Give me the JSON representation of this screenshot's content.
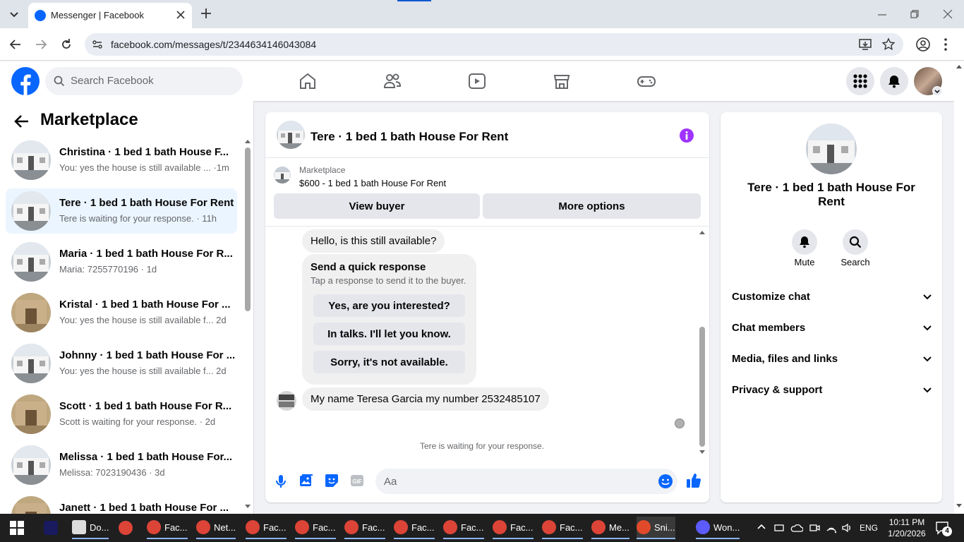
{
  "browser": {
    "tab_title": "Messenger | Facebook",
    "url": "facebook.com/messages/t/2344634146043084"
  },
  "fb": {
    "search_placeholder": "Search Facebook"
  },
  "left": {
    "title": "Marketplace",
    "conversations": [
      {
        "title": "Christina · 1 bed 1 bath House F...",
        "preview": "You: yes the house is still available ... ·1m",
        "thumb": "white"
      },
      {
        "title": "Tere · 1 bed 1 bath House For Rent",
        "preview": "Tere is waiting for your response. · 11h",
        "thumb": "white"
      },
      {
        "title": "Maria · 1 bed 1 bath House For R...",
        "preview": "Maria: 7255770196 · 1d",
        "thumb": "white"
      },
      {
        "title": "Kristal · 1 bed 1 bath House For ...",
        "preview": "You: yes the house is still available f... 2d",
        "thumb": "tan"
      },
      {
        "title": "Johnny · 1 bed 1 bath House For ...",
        "preview": "You: yes the house is still available f... 2d",
        "thumb": "white"
      },
      {
        "title": "Scott · 1 bed 1 bath House For R...",
        "preview": "Scott is waiting for your response. · 2d",
        "thumb": "tan"
      },
      {
        "title": "Melissa · 1 bed 1 bath House For...",
        "preview": "Melissa: 7023190436 · 3d",
        "thumb": "white"
      },
      {
        "title": "Janett · 1 bed 1 bath House For ...",
        "preview": "",
        "thumb": "tan"
      }
    ]
  },
  "chat": {
    "title": "Tere · 1 bed 1 bath House For Rent",
    "listing_label": "Marketplace",
    "listing_title": "$600 - 1 bed 1 bath House For Rent",
    "view_buyer": "View buyer",
    "more_options": "More options",
    "msg1": "Hello, is this still available?",
    "quick_title": "Send a quick response",
    "quick_sub": "Tap a response to send it to the buyer.",
    "quick_options": [
      "Yes, are you interested?",
      "In talks. I'll let you know.",
      "Sorry, it's not available."
    ],
    "msg2": "My name Teresa Garcia my number 2532485107",
    "status": "Tere is waiting for your response.",
    "composer_placeholder": "Aa"
  },
  "right": {
    "name": "Tere · 1 bed 1 bath House For Rent",
    "mute": "Mute",
    "search": "Search",
    "sections": [
      "Customize chat",
      "Chat members",
      "Media, files and links",
      "Privacy & support"
    ]
  },
  "taskbar": {
    "items": [
      {
        "label": "",
        "icon": "premiere-icon",
        "color": "#1a1a5e"
      },
      {
        "label": "Do...",
        "icon": "document-icon",
        "color": "#dddddd"
      },
      {
        "label": "",
        "icon": "chrome-icon",
        "color": "#db4437"
      },
      {
        "label": "Fac...",
        "icon": "chrome-icon",
        "color": "#db4437"
      },
      {
        "label": "Net...",
        "icon": "chrome-icon",
        "color": "#db4437"
      },
      {
        "label": "Fac...",
        "icon": "chrome-icon",
        "color": "#db4437"
      },
      {
        "label": "Fac...",
        "icon": "chrome-icon",
        "color": "#db4437"
      },
      {
        "label": "Fac...",
        "icon": "chrome-icon",
        "color": "#db4437"
      },
      {
        "label": "Fac...",
        "icon": "chrome-icon",
        "color": "#db4437"
      },
      {
        "label": "Fac...",
        "icon": "chrome-icon",
        "color": "#db4437"
      },
      {
        "label": "Fac...",
        "icon": "chrome-icon",
        "color": "#db4437"
      },
      {
        "label": "Fac...",
        "icon": "chrome-icon",
        "color": "#db4437"
      },
      {
        "label": "Me...",
        "icon": "chrome-icon",
        "color": "#db4437"
      },
      {
        "label": "Sni...",
        "icon": "snipping-tool-icon",
        "color": "#e04a2a"
      },
      {
        "label": "Won...",
        "icon": "wondershare-icon",
        "color": "#5b5bff"
      }
    ],
    "language": "ENG",
    "time": "10:11 PM",
    "date": "1/20/2026",
    "notifications": "4"
  },
  "colors": {
    "fb_blue": "#0866ff",
    "active_bg": "#ebf5ff",
    "info_purple": "#a033ff"
  }
}
